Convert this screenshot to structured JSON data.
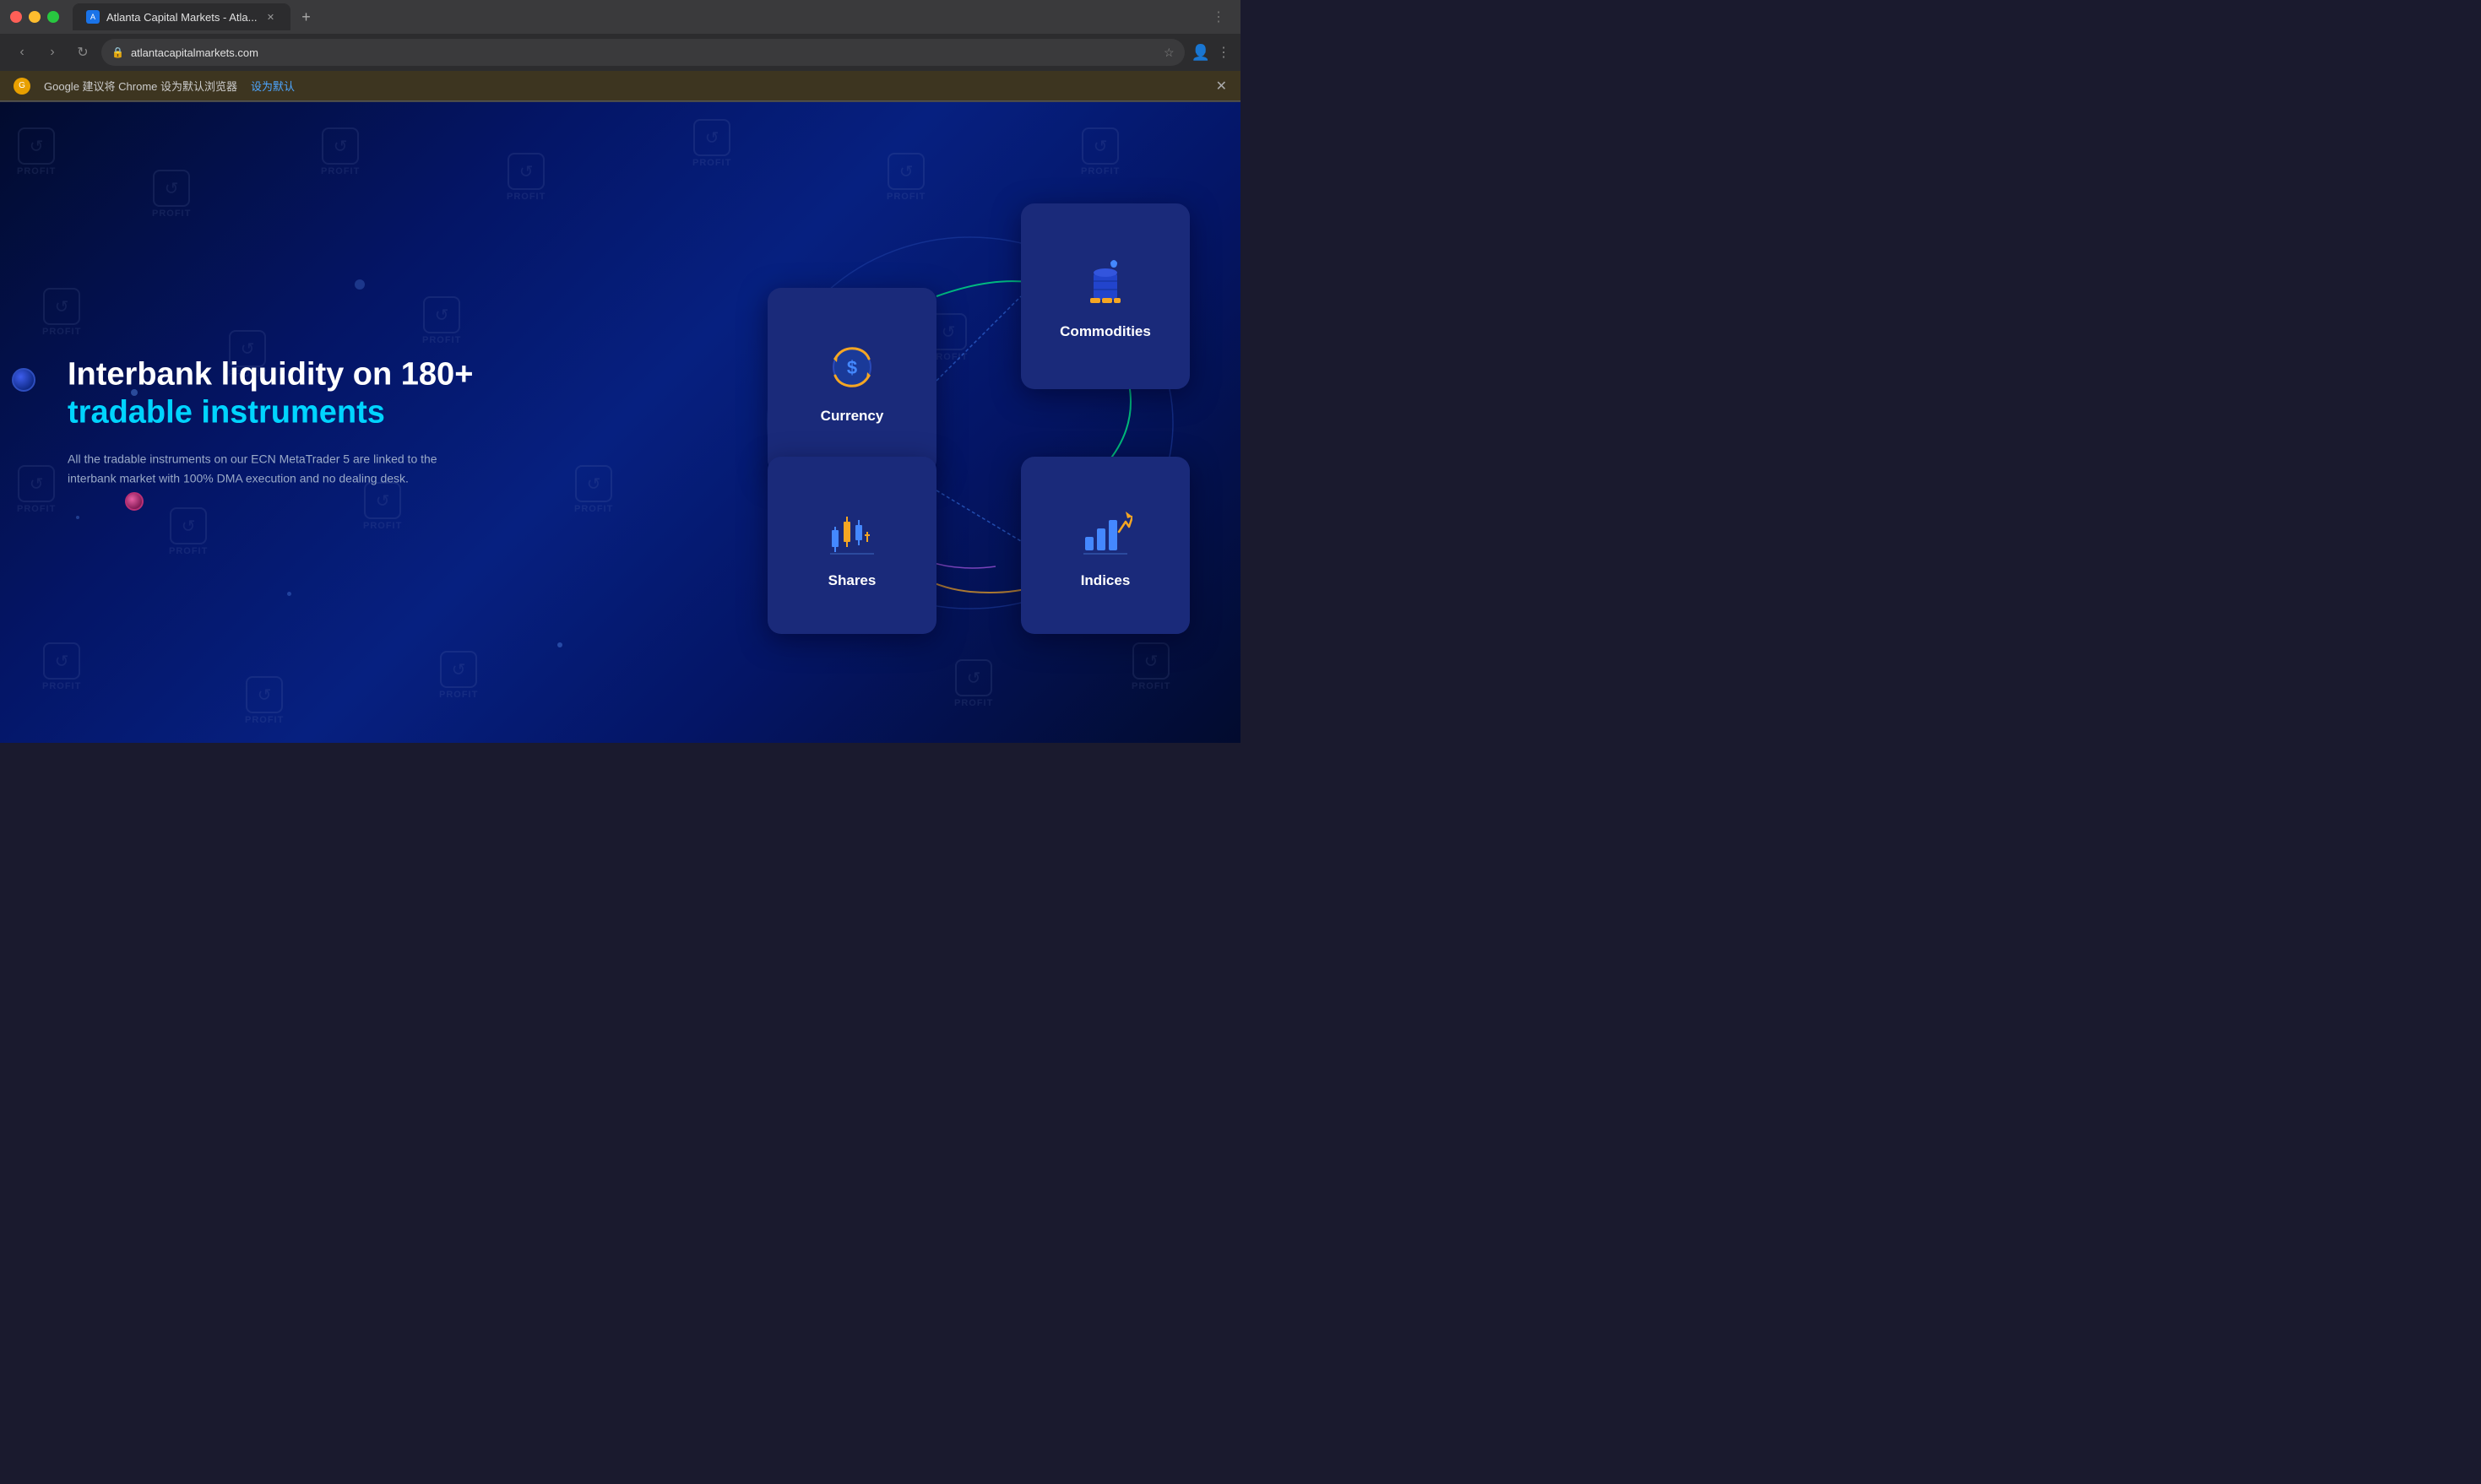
{
  "browser": {
    "title": "Atlanta Capital Markets - Atla...",
    "url": "atlantacapitalmarkets.com",
    "new_tab_label": "+",
    "info_bar_text": "Google 建议将 Chrome 设为默认浏览器",
    "info_bar_link": "设为默认",
    "nav": {
      "back": "‹",
      "forward": "›",
      "refresh": "↻"
    }
  },
  "page": {
    "headline_line1": "Interbank liquidity on 180+",
    "headline_line2": "tradable instruments",
    "description": "All the tradable instruments on our ECN MetaTrader 5 are linked to the interbank market with 100% DMA execution and no dealing desk.",
    "cards": [
      {
        "id": "currency",
        "label": "Currency",
        "icon_type": "currency"
      },
      {
        "id": "commodities",
        "label": "Commodities",
        "icon_type": "commodities"
      },
      {
        "id": "shares",
        "label": "Shares",
        "icon_type": "shares"
      },
      {
        "id": "indices",
        "label": "Indices",
        "icon_type": "indices"
      }
    ]
  },
  "colors": {
    "accent_cyan": "#00d4ff",
    "accent_orange": "#f5a623",
    "card_bg": "#1a2a7a",
    "page_bg_dark": "#020b2e"
  }
}
